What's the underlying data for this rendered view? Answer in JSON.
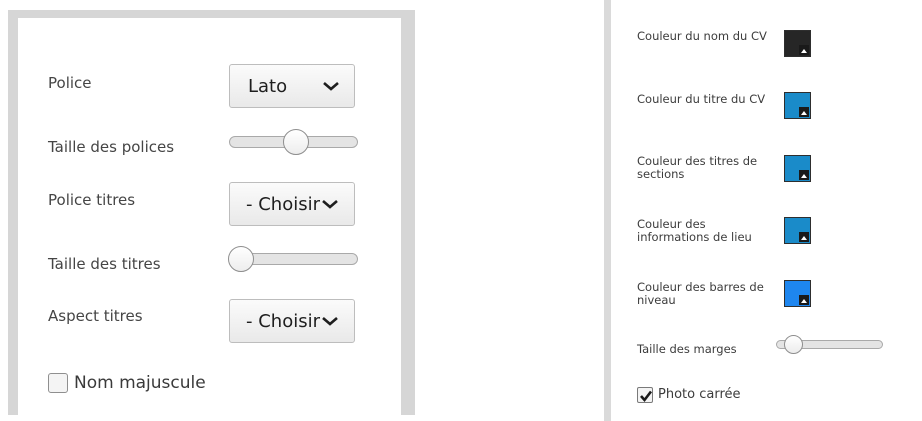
{
  "left": {
    "font_label": "Police",
    "font_value": "Lato",
    "font_size_label": "Taille des polices",
    "font_size_level": 0.52,
    "title_font_label": "Police titres",
    "title_font_value": "- Choisir",
    "title_size_label": "Taille des titres",
    "title_size_level": 0.0,
    "title_aspect_label": "Aspect titres",
    "title_aspect_value": "- Choisir",
    "uppercase_name_label": "Nom majuscule",
    "uppercase_name_checked": false
  },
  "right": {
    "colors": [
      {
        "label": "Couleur du nom du CV",
        "color": "#262626"
      },
      {
        "label": "Couleur du titre du CV",
        "color": "#1a8bc9"
      },
      {
        "label": "Couleur des titres de sections",
        "color": "#1a8bc9"
      },
      {
        "label": "Couleur des informations de lieu",
        "color": "#1a8bc9"
      },
      {
        "label": "Couleur des barres de niveau",
        "color": "#1e86ef"
      }
    ],
    "margin_size_label": "Taille des marges",
    "margin_size_level": 0.15,
    "square_photo_label": "Photo carrée",
    "square_photo_checked": true
  }
}
